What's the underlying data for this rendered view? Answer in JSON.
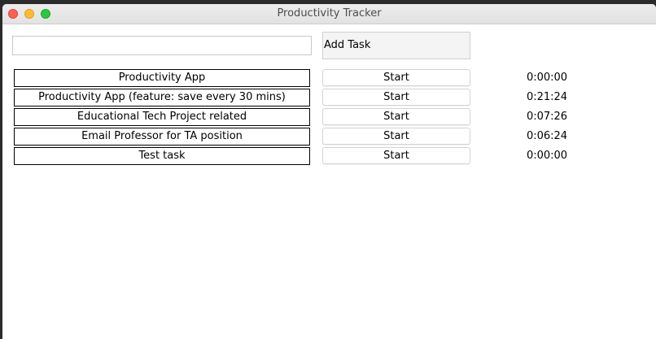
{
  "window": {
    "title": "Productivity Tracker"
  },
  "input": {
    "value": "",
    "placeholder": ""
  },
  "add_button": {
    "label": "Add Task"
  },
  "tasks": [
    {
      "name": "Productivity App",
      "button": "Start",
      "time": "0:00:00"
    },
    {
      "name": "Productivity App (feature: save every 30 mins)",
      "button": "Start",
      "time": "0:21:24"
    },
    {
      "name": "Educational Tech Project related",
      "button": "Start",
      "time": "0:07:26"
    },
    {
      "name": "Email Professor for TA position",
      "button": "Start",
      "time": "0:06:24"
    },
    {
      "name": "Test task",
      "button": "Start",
      "time": "0:00:00"
    }
  ]
}
